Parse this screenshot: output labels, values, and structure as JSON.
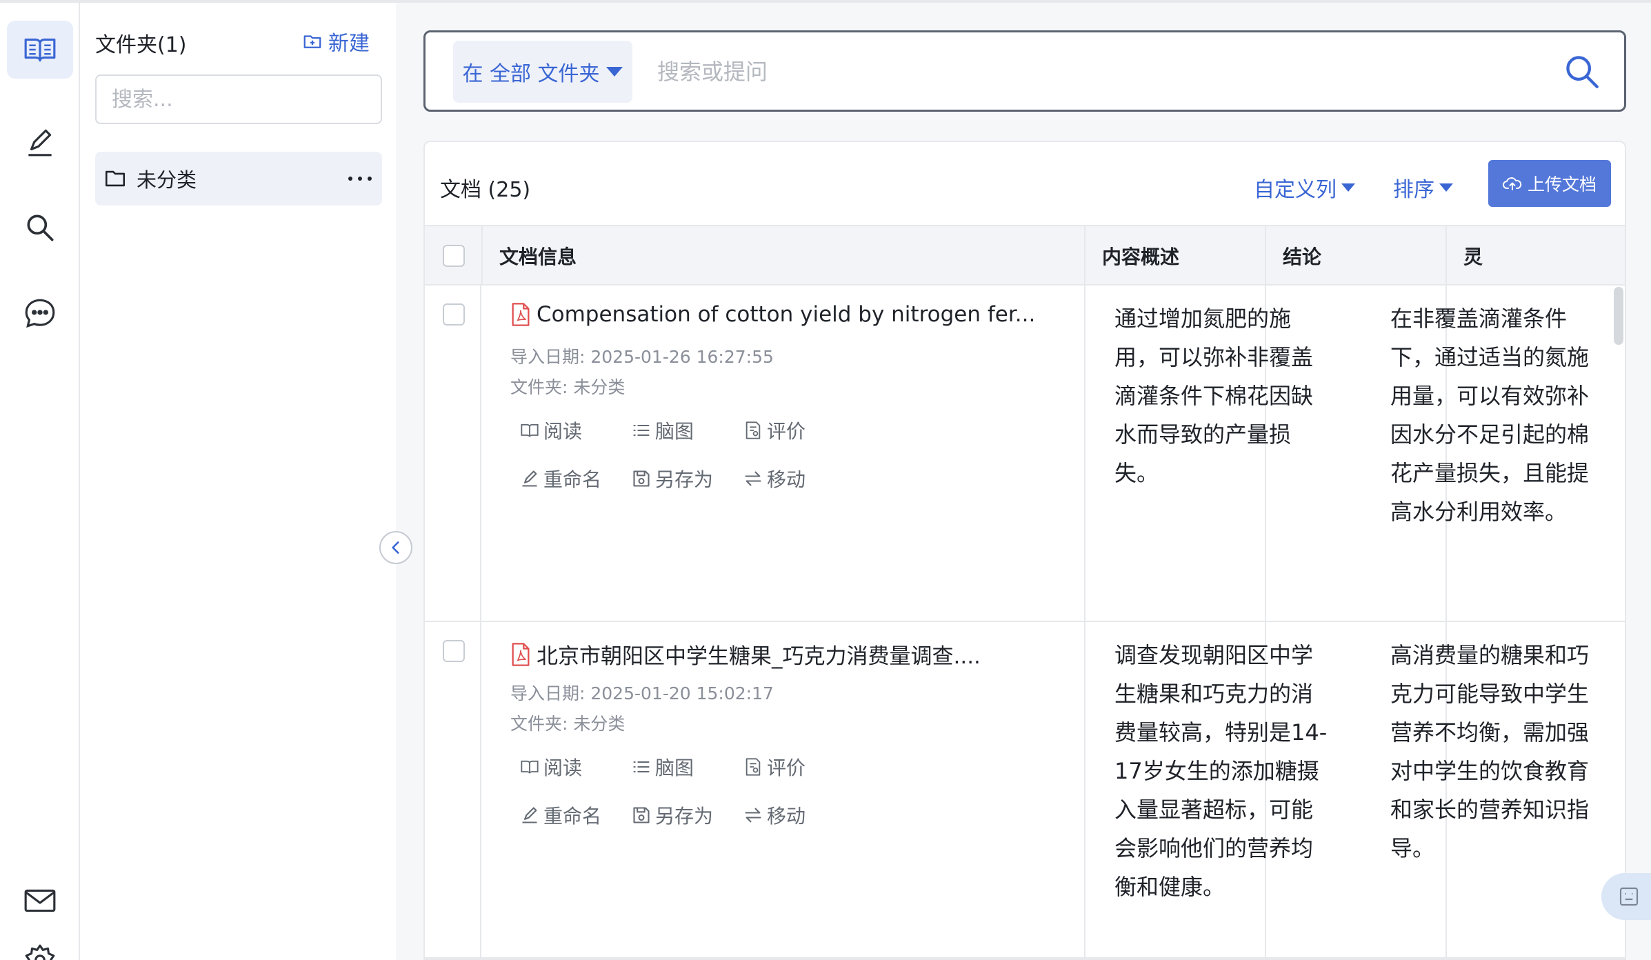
{
  "folders": {
    "title": "文件夹(1)",
    "new_label": "新建",
    "search_placeholder": "搜索...",
    "items": [
      {
        "label": "未分类"
      }
    ]
  },
  "search": {
    "scope_label": "在 全部 文件夹",
    "placeholder": "搜索或提问"
  },
  "documents": {
    "title": "文档 (25)",
    "custom_columns_label": "自定义列",
    "sort_label": "排序",
    "upload_label": "上传文档",
    "columns": [
      "文档信息",
      "内容概述",
      "结论",
      "灵"
    ],
    "actions": {
      "read": "阅读",
      "mindmap": "脑图",
      "review": "评价",
      "rename": "重命名",
      "save_as": "另存为",
      "move": "移动"
    },
    "rows": [
      {
        "title": "Compensation of cotton yield by nitrogen fer...",
        "import_date": "导入日期: 2025-01-26 16:27:55",
        "folder": "文件夹: 未分类",
        "summary": "通过增加氮肥的施用，可以弥补非覆盖滴灌条件下棉花因缺水而导致的产量损失。",
        "conclusion": "在非覆盖滴灌条件下，通过适当的氮施用量，可以有效弥补因水分不足引起的棉花产量损失，且能提高水分利用效率。"
      },
      {
        "title": "北京市朝阳区中学生糖果_巧克力消费量调查....",
        "import_date": "导入日期: 2025-01-20 15:02:17",
        "folder": "文件夹: 未分类",
        "summary": "调查发现朝阳区中学生糖果和巧克力的消费量较高，特别是14-17岁女生的添加糖摄入量显著超标，可能会影响他们的营养均衡和健康。",
        "conclusion": "高消费量的糖果和巧克力可能导致中学生营养不均衡，需加强对中学生的饮食教育和家长的营养知识指导。"
      }
    ]
  },
  "colors": {
    "accent": "#3a66d4",
    "upload_button": "#5478d9",
    "active_bg": "#e9eefb",
    "pdf_icon": "#e04f4f"
  },
  "icons": {
    "rail": [
      "book-icon",
      "pen-icon",
      "search-icon",
      "chat-icon",
      "mail-icon",
      "gear-icon"
    ]
  }
}
